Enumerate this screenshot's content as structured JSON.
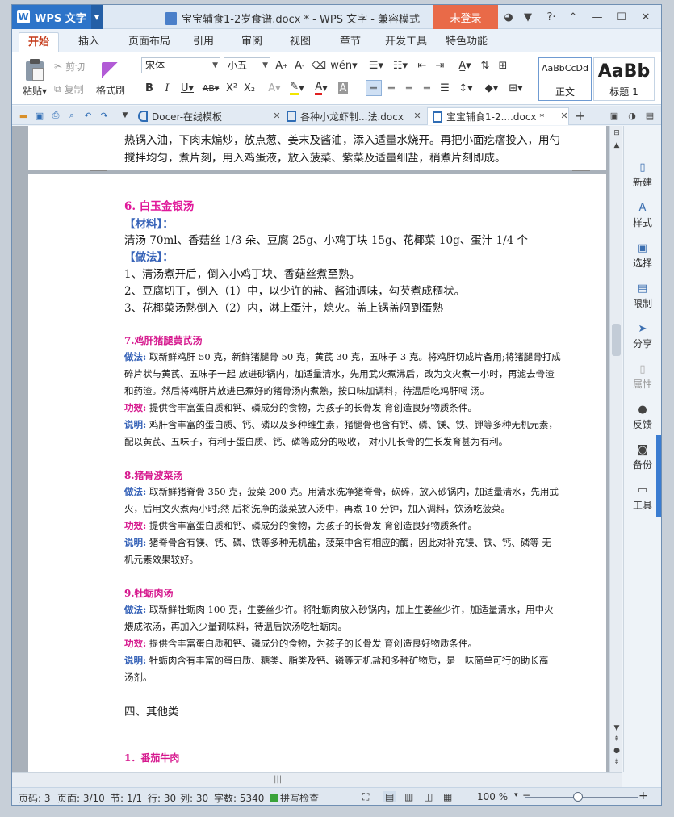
{
  "window": {
    "app_name": "WPS 文字",
    "title": "宝宝辅食1-2岁食谱.docx * - WPS 文字 - 兼容模式",
    "login": "未登录"
  },
  "menu": {
    "tabs": [
      "开始",
      "插入",
      "页面布局",
      "引用",
      "审阅",
      "视图",
      "章节",
      "开发工具",
      "特色功能"
    ]
  },
  "ribbon": {
    "paste": "粘贴",
    "cut": "剪切",
    "copy": "复制",
    "format_painter": "格式刷",
    "font_name": "宋体",
    "font_size": "小五",
    "styles": [
      {
        "preview": "AaBbCcDd",
        "name": "正文"
      },
      {
        "preview": "AaBb",
        "name": "标题 1"
      }
    ]
  },
  "tabs": [
    {
      "label": "Docer-在线模板"
    },
    {
      "label": "各种小龙虾制...法.docx"
    },
    {
      "label": "宝宝辅食1-2....docx *"
    }
  ],
  "doc": {
    "prev_lines": [
      "热锅入油，下肉末煸炒，放点葱、姜末及酱油，添入适量水烧开。再把小面疙瘩投入，用勺",
      "搅拌均匀，煮片刻，用入鸡蛋液，放入菠菜、紫菜及适量细盐，稍煮片刻即成。"
    ],
    "r6": {
      "title": "6. 白玉金银汤",
      "ingredients_label": "【材料】：",
      "ingredients": "清汤 70ml、香菇丝 1/3 朵、豆腐 25g、小鸡丁块 15g、花椰菜 10g、蛋汁 1/4 个",
      "method_label": "【做法】：",
      "steps": [
        "1、清汤煮开后，倒入小鸡丁块、香菇丝煮至熟。",
        "2、豆腐切丁，倒入（1）中，以少许的盐、酱油调味，勾芡煮成稠状。",
        "3、花椰菜汤熟倒入（2）内，淋上蛋汁，熄火。盖上锅盖闷到蛋熟"
      ]
    },
    "r7": {
      "title": "7.鸡肝猪腿黄芪汤",
      "method_label": "做法:",
      "method": [
        "取新鲜鸡肝 50 克，新鲜猪腿骨 50 克，黄芪 30 克，五味子 3 克。将鸡肝切成片备用;将猪腿骨打成",
        "碎片状与黄芪、五味子一起 放进砂锅内，加适量清水，先用武火煮沸后，改为文火煮一小时，再滤去骨渣",
        "和药渣。然后将鸡肝片放进已煮好的猪骨汤内煮熟，按口味加调料，待温后吃鸡肝喝 汤。"
      ],
      "effect_label": "功效:",
      "effect": "提供含丰富蛋白质和钙、磷成分的食物，为孩子的长骨发 育创造良好物质条件。",
      "note_label": "说明:",
      "note": [
        "鸡肝含丰富的蛋白质、钙、磷以及多种维生素，猪腿骨也含有钙、磷、镁、铁、钾等多种无机元素，",
        "配以黄芪、五味子，有利于蛋白质、钙、磷等成分的吸收， 对小儿长骨的生长发育甚为有利。"
      ]
    },
    "r8": {
      "title": "8.猪骨波菜汤",
      "method_label": "做法:",
      "method": [
        "取新鲜猪脊骨 350 克，菠菜 200 克。用清水洗净猪脊骨，砍碎，放入砂锅内，加适量清水，先用武",
        "火，后用文火煮两小时;然 后将洗净的菠菜放入汤中，再煮 10 分钟，加入调料，饮汤吃菠菜。"
      ],
      "effect_label": "功效:",
      "effect": "提供含丰富蛋白质和钙、磷成分的食物，为孩子的长骨发 育创造良好物质条件。",
      "note_label": "说明:",
      "note": [
        "猪脊骨含有镁、钙、磷、铁等多种无机盐，菠菜中含有相应的酶，因此对补充镁、铁、钙、磷等 无",
        "机元素效果较好。"
      ]
    },
    "r9": {
      "title": "9.牡蛎肉汤",
      "method_label": "做法:",
      "method": [
        "取新鲜牡蛎肉 100 克，生姜丝少许。将牡蛎肉放入砂锅内，加上生姜丝少许，加适量清水，用中火",
        "煨成浓汤，再加入少量调味料，待温后饮汤吃牡蛎肉。"
      ],
      "effect_label": "功效:",
      "effect": "提供含丰富蛋白质和钙、磷成分的食物，为孩子的长骨发 育创造良好物质条件。",
      "note_label": "说明:",
      "note": [
        "牡蛎肉含有丰富的蛋白质、糖类、脂类及钙、磷等无机盐和多种矿物质，是一味简单可行的助长高",
        "汤剂。"
      ]
    },
    "section": "四、其他类",
    "r1": "1．番茄牛肉"
  },
  "taskpane": [
    "新建",
    "样式",
    "选择",
    "限制",
    "分享",
    "属性",
    "反馈",
    "备份",
    "工具"
  ],
  "status": {
    "page_code": "页码: 3",
    "pages": "页面: 3/10",
    "section": "节: 1/1",
    "row": "行: 30",
    "col": "列: 30",
    "words": "字数: 5340",
    "spell": "拼写检查",
    "zoom": "100 %"
  }
}
